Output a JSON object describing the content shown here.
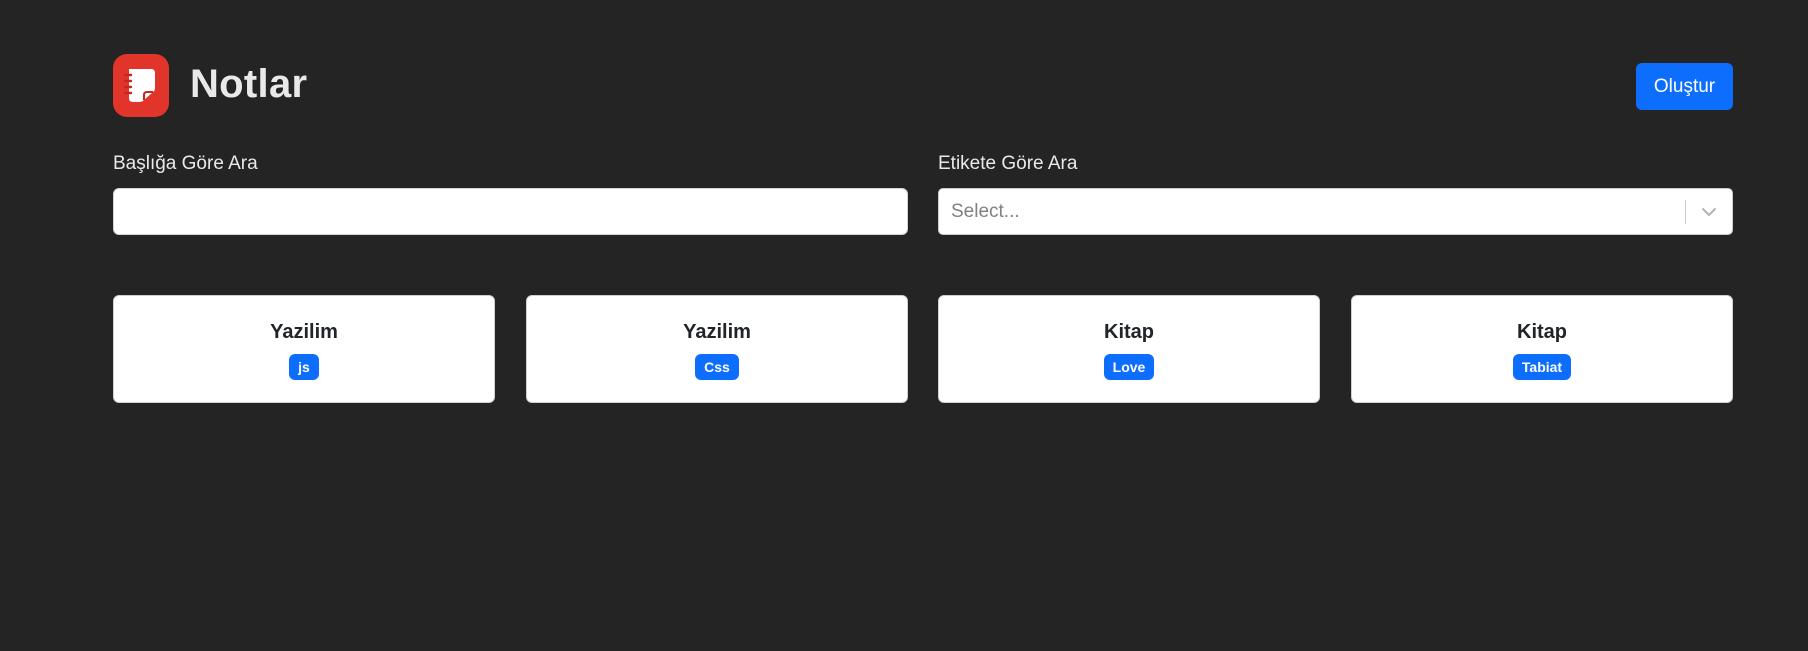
{
  "header": {
    "title": "Notlar",
    "create_label": "Oluştur"
  },
  "search": {
    "title_label": "Başlığa Göre Ara",
    "title_value": "",
    "tag_label": "Etikete Göre Ara",
    "tag_placeholder": "Select..."
  },
  "notes": [
    {
      "title": "Yazilim",
      "tag": "js"
    },
    {
      "title": "Yazilim",
      "tag": "Css"
    },
    {
      "title": "Kitap",
      "tag": "Love"
    },
    {
      "title": "Kitap",
      "tag": "Tabiat"
    }
  ],
  "colors": {
    "background": "#242424",
    "accent": "#0d6efd",
    "logo": "#e1352b"
  },
  "icons": {
    "logo": "notes-app-logo-icon",
    "dropdown": "chevron-down-icon"
  }
}
